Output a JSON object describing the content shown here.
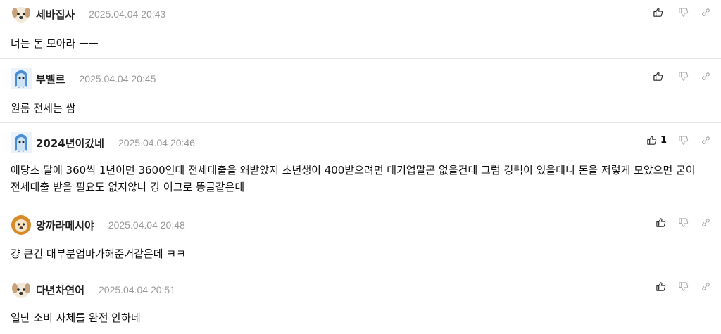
{
  "comments": [
    {
      "nick": "세바집사",
      "date": "2025.04.04 20:43",
      "body": "너는 돈 모아라 ㅡㅡ",
      "avatar": "dog-face-icon",
      "likes": ""
    },
    {
      "nick": "부벨르",
      "date": "2025.04.04 20:45",
      "body": "원룸 전세는 쌈",
      "avatar": "ghost-avatar-icon",
      "likes": ""
    },
    {
      "nick": "2024년이갔네",
      "date": "2025.04.04 20:46",
      "body": "애당초 달에 360씩 1년이면 3600인데 전세대출을 왜받았지 초년생이 400받으려면 대기업말곤 없을건데 그럼 경력이 있을테니 돈을 저렇게 모았으면 굳이 전세대출 받을 필요도 없지않나 걍 어그로 똥글같은데",
      "avatar": "ghost-avatar-icon",
      "likes": "1"
    },
    {
      "nick": "앙까라메시야",
      "date": "2025.04.04 20:48",
      "body": "걍 큰건 대부분엄마가해준거같은데 ㅋㅋ",
      "avatar": "lion-avatar-icon",
      "likes": ""
    },
    {
      "nick": "다년차연어",
      "date": "2025.04.04 20:51",
      "body": "일단 소비 자체를 완전 안하네",
      "avatar": "dog-face-icon",
      "likes": ""
    }
  ],
  "icons": {
    "like": "thumbs-up-icon",
    "dislike": "thumbs-down-icon",
    "link": "link-icon"
  },
  "colors": {
    "text": "#111111",
    "date": "#9a9a9a",
    "divider": "#e6e6e6"
  }
}
